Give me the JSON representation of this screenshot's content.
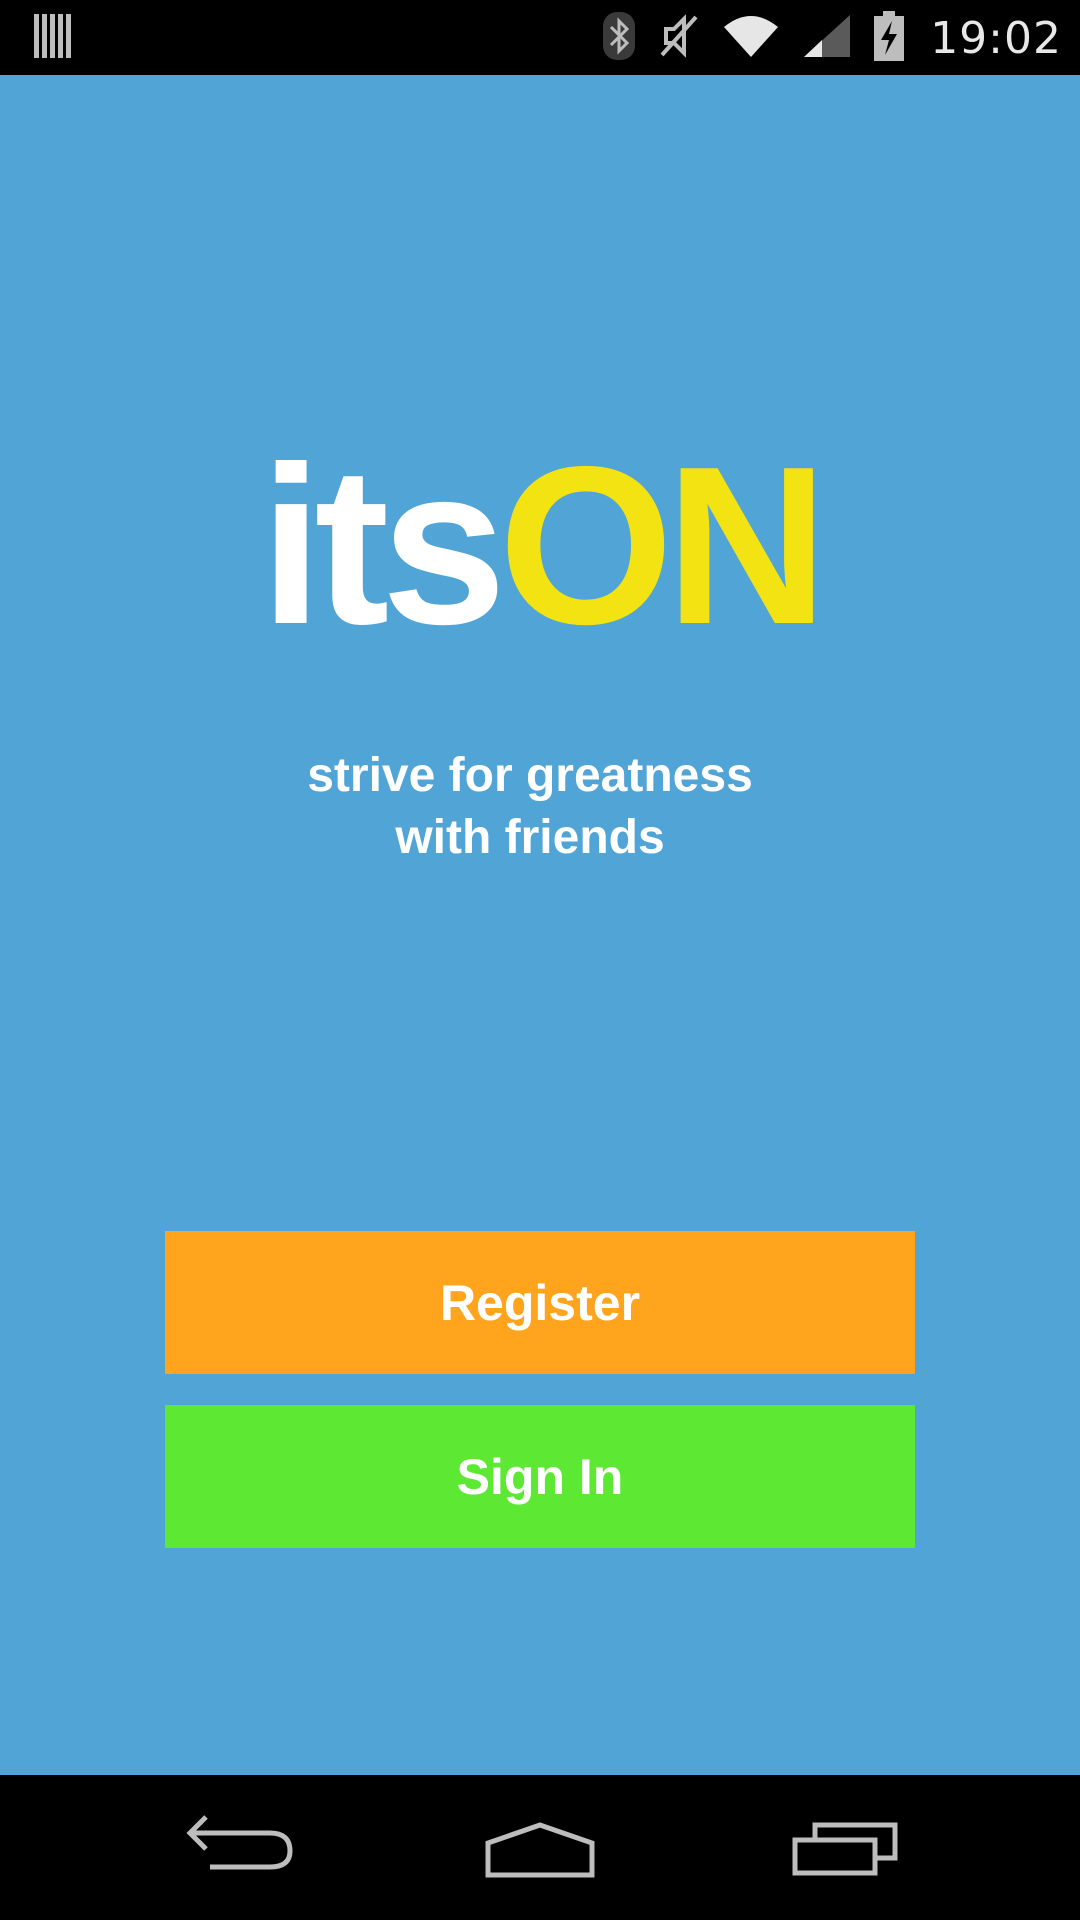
{
  "status_bar": {
    "time": "19:02",
    "icons": [
      "notification-barcode-icon",
      "bluetooth-icon",
      "mute-icon",
      "wifi-icon",
      "signal-icon",
      "battery-charging-icon"
    ]
  },
  "app": {
    "logo_part1": "its",
    "logo_part2": "ON",
    "tagline_line1": "strive for greatness",
    "tagline_line2": "with friends",
    "register_label": "Register",
    "signin_label": "Sign In"
  },
  "nav_bar": {
    "icons": [
      "back-icon",
      "home-icon",
      "recents-icon"
    ]
  },
  "colors": {
    "background": "#50a5d6",
    "logo_white": "#ffffff",
    "logo_accent": "#f3e313",
    "register_button": "#ffa41c",
    "signin_button": "#5de833",
    "system_bars": "#000000"
  }
}
